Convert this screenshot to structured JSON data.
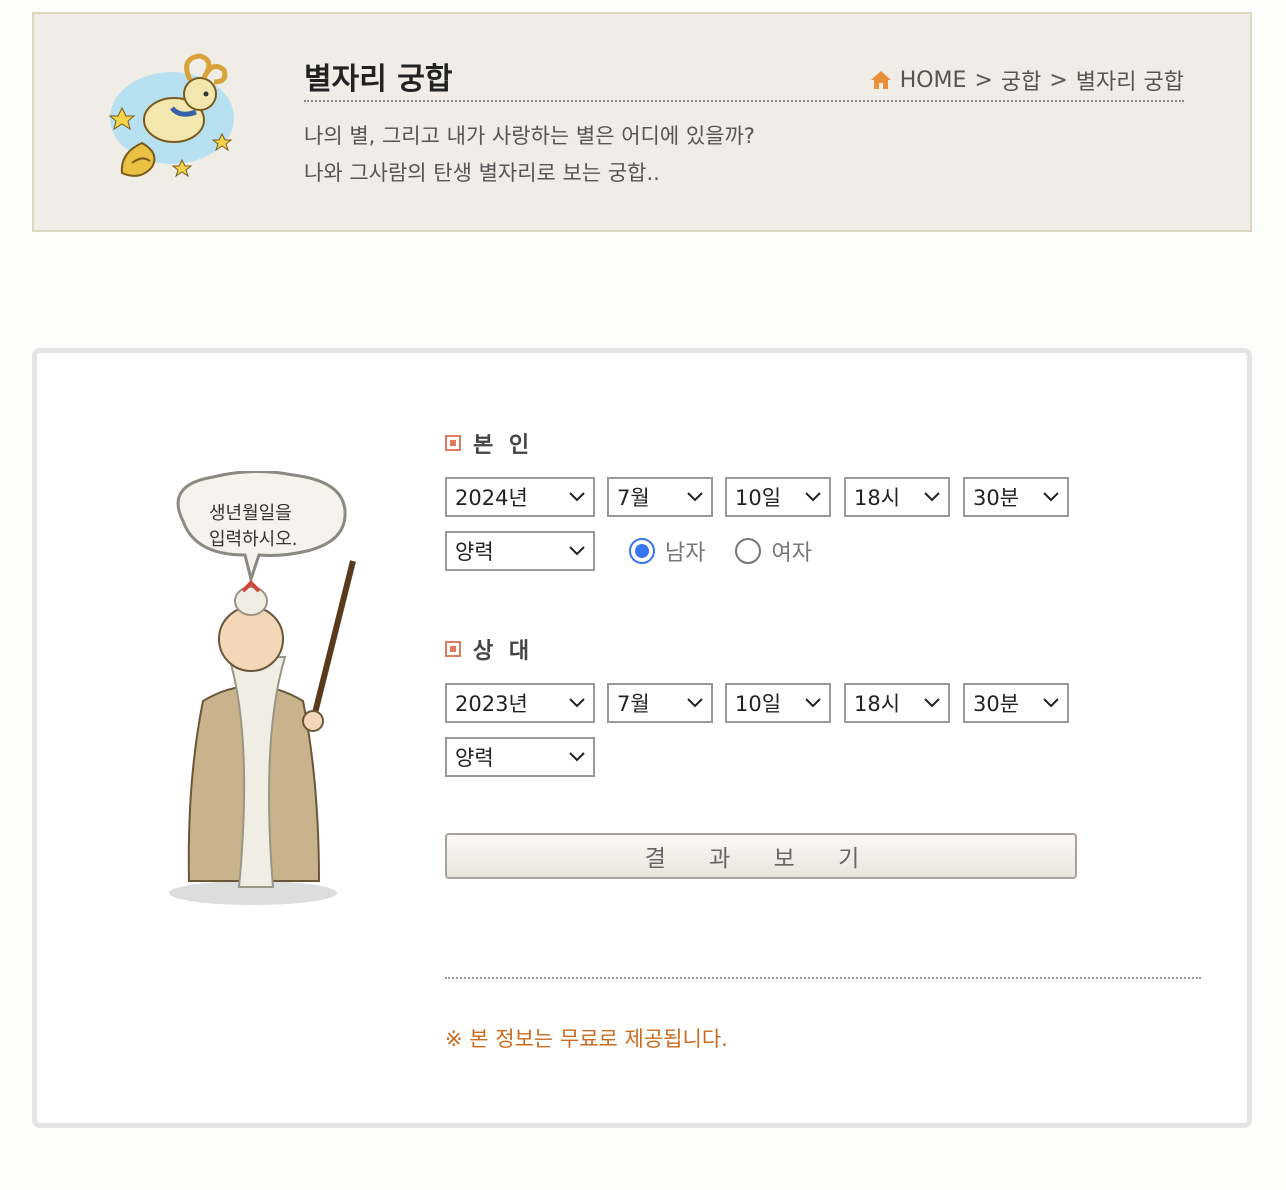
{
  "header": {
    "title": "별자리 궁합",
    "breadcrumb": [
      "HOME",
      ">",
      "궁합",
      ">",
      "별자리 궁합"
    ],
    "desc_line1": "나의 별, 그리고 내가 사랑하는 별은 어디에 있을까?",
    "desc_line2": "나와 그사람의 탄생 별자리로 보는 궁합..",
    "home_icon": "home-icon",
    "zodiac_icon": "capricorn-illustration"
  },
  "form": {
    "speech_bubble_line1": "생년월일을",
    "speech_bubble_line2": "입력하시오.",
    "self": {
      "label": "본 인",
      "year": "2024년",
      "month": "7월",
      "day": "10일",
      "hour": "18시",
      "minute": "30분",
      "calendar": "양력",
      "gender_options": [
        "남자",
        "여자"
      ],
      "gender_selected": "남자"
    },
    "partner": {
      "label": "상 대",
      "year": "2023년",
      "month": "7월",
      "day": "10일",
      "hour": "18시",
      "minute": "30분",
      "calendar": "양력"
    },
    "submit_label": "결 과 보 기",
    "notice": "※ 본 정보는 무료로 제공됩니다."
  },
  "colors": {
    "header_bg": "#efede6",
    "accent_orange": "#e8913a",
    "label_square": "#e07b5f",
    "notice": "#cc6a1f",
    "radio_checked": "#3a75f0"
  }
}
